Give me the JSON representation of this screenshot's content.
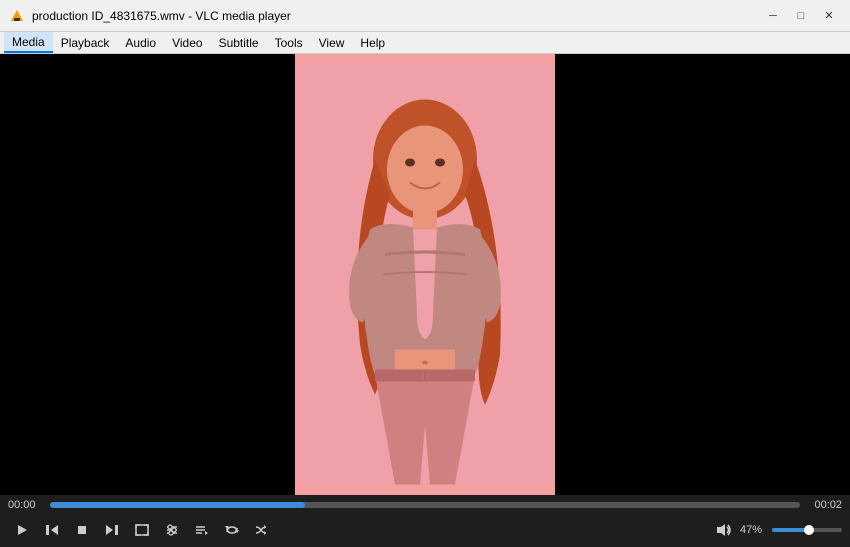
{
  "titlebar": {
    "title": "production ID_4831675.wmv - VLC media player",
    "minimize": "─",
    "maximize": "□",
    "close": "✕"
  },
  "menu": {
    "items": [
      "Media",
      "Playback",
      "Audio",
      "Video",
      "Subtitle",
      "Tools",
      "View",
      "Help"
    ]
  },
  "controls": {
    "time_start": "00:00",
    "time_end": "00:02",
    "volume_pct": "47%",
    "progress_width": "34%",
    "volume_width": "47%"
  }
}
